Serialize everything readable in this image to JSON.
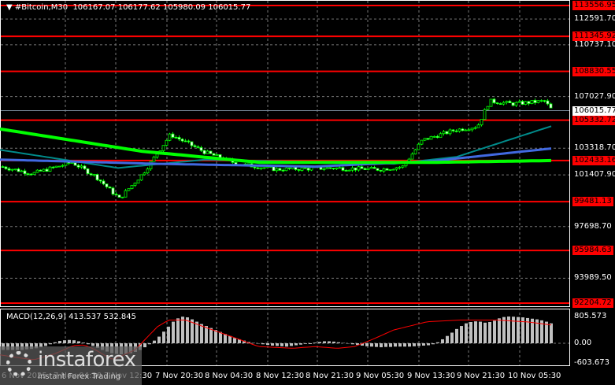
{
  "header": {
    "symbol": "#Bitcoin,M30",
    "open": "106167.07",
    "high": "106177.62",
    "low": "105980.09",
    "close": "106015.77"
  },
  "price_scale": [
    {
      "v": 112591.7,
      "t": "112591.70"
    },
    {
      "v": 110737.1,
      "t": "110737.10"
    },
    {
      "v": 107027.9,
      "t": "107027.90"
    },
    {
      "v": 103318.7,
      "t": "103318.70"
    },
    {
      "v": 101407.9,
      "t": "101407.90"
    },
    {
      "v": 97698.7,
      "t": "97698.70"
    },
    {
      "v": 93989.5,
      "t": "93989.50"
    }
  ],
  "levels": [
    {
      "v": 113556.95,
      "t": "113556.95"
    },
    {
      "v": 111345.92,
      "t": "111345.92"
    },
    {
      "v": 108830.55,
      "t": "108830.55"
    },
    {
      "v": 105332.72,
      "t": "105332.72"
    },
    {
      "v": 102433.16,
      "t": "102433.16"
    },
    {
      "v": 99481.13,
      "t": "99481.13"
    },
    {
      "v": 95984.63,
      "t": "95984.63"
    },
    {
      "v": 92204.72,
      "t": "92204.72"
    }
  ],
  "current_price": {
    "v": 106015.77,
    "t": "106015.77"
  },
  "macd": {
    "label": "MACD(12,26,9) 413.537 532.845",
    "scale": [
      "805.573",
      "0.00",
      "-603.673"
    ]
  },
  "time_labels": [
    "6 Nov 2025",
    "7 Nov 04:30",
    "7 Nov 12:30",
    "7 Nov 20:30",
    "8 Nov 04:30",
    "8 Nov 12:30",
    "8 Nov 21:30",
    "9 Nov 05:30",
    "9 Nov 13:30",
    "9 Nov 21:30",
    "10 Nov 05:30"
  ],
  "price_path": [
    [
      0,
      102000
    ],
    [
      40,
      101500
    ],
    [
      90,
      102300
    ],
    [
      120,
      101300
    ],
    [
      150,
      99700
    ],
    [
      180,
      101500
    ],
    [
      215,
      104300
    ],
    [
      260,
      103000
    ],
    [
      300,
      102200
    ],
    [
      350,
      101800
    ],
    [
      420,
      101900
    ],
    [
      480,
      101800
    ],
    [
      510,
      102000
    ],
    [
      535,
      103900
    ],
    [
      575,
      104600
    ],
    [
      605,
      104900
    ],
    [
      620,
      106700
    ],
    [
      650,
      106500
    ],
    [
      690,
      106700
    ],
    [
      700,
      106015
    ]
  ],
  "ma_green": [
    [
      0,
      104700
    ],
    [
      180,
      103100
    ],
    [
      330,
      102300
    ],
    [
      550,
      102300
    ],
    [
      700,
      102433
    ]
  ],
  "ma_blue": [
    [
      0,
      102500
    ],
    [
      200,
      102200
    ],
    [
      400,
      102000
    ],
    [
      550,
      102400
    ],
    [
      700,
      103300
    ]
  ],
  "ma_teal": [
    [
      0,
      103200
    ],
    [
      150,
      101900
    ],
    [
      260,
      102500
    ],
    [
      500,
      102200
    ],
    [
      580,
      102700
    ],
    [
      700,
      104900
    ]
  ],
  "macd_hist": [
    -200,
    -200,
    -200,
    -200,
    -200,
    -180,
    -170,
    -150,
    -120,
    -80,
    -30,
    30,
    70,
    90,
    100,
    90,
    60,
    20,
    -30,
    -80,
    -140,
    -200,
    -250,
    -300,
    -320,
    -330,
    -320,
    -300,
    -260,
    -200,
    -120,
    -30,
    80,
    200,
    350,
    500,
    650,
    750,
    800,
    780,
    720,
    650,
    580,
    520,
    460,
    400,
    340,
    280,
    220,
    160,
    120,
    80,
    40,
    10,
    -10,
    -30,
    -50,
    -70,
    -80,
    -90,
    -100,
    -80,
    -60,
    -40,
    -20,
    0,
    20,
    40,
    60,
    60,
    50,
    30,
    10,
    -10,
    -30,
    -50,
    -70,
    -90,
    -100,
    -110,
    -120,
    -110,
    -110,
    -100,
    -100,
    -100,
    -100,
    -90,
    -80,
    -70,
    -60,
    -30,
    30,
    120,
    220,
    320,
    430,
    520,
    600,
    640,
    660,
    650,
    620,
    640,
    680,
    750,
    790,
    805,
    800,
    790,
    780,
    760,
    740,
    720,
    690,
    650,
    600,
    540
  ],
  "macd_signal_path": [
    [
      0,
      -350
    ],
    [
      60,
      -500
    ],
    [
      100,
      -300
    ],
    [
      130,
      -70
    ],
    [
      150,
      -50
    ],
    [
      170,
      -200
    ],
    [
      200,
      -500
    ],
    [
      240,
      -200
    ],
    [
      280,
      500
    ],
    [
      300,
      700
    ],
    [
      330,
      700
    ],
    [
      370,
      450
    ],
    [
      420,
      150
    ],
    [
      460,
      -100
    ],
    [
      520,
      -150
    ],
    [
      560,
      -100
    ],
    [
      600,
      -150
    ],
    [
      630,
      -100
    ],
    [
      660,
      100
    ],
    [
      700,
      400
    ],
    [
      760,
      650
    ],
    [
      820,
      700
    ],
    [
      880,
      700
    ],
    [
      940,
      640
    ],
    [
      980,
      550
    ]
  ],
  "brand": {
    "name": "instaforex",
    "tagline": "Instant Forex Trading"
  },
  "colors": {
    "bull": "#00ff00",
    "level": "#ff0000",
    "green_ma": "#00ff00",
    "blue_ma": "#4169e1",
    "teal_ma": "#008b8b"
  }
}
